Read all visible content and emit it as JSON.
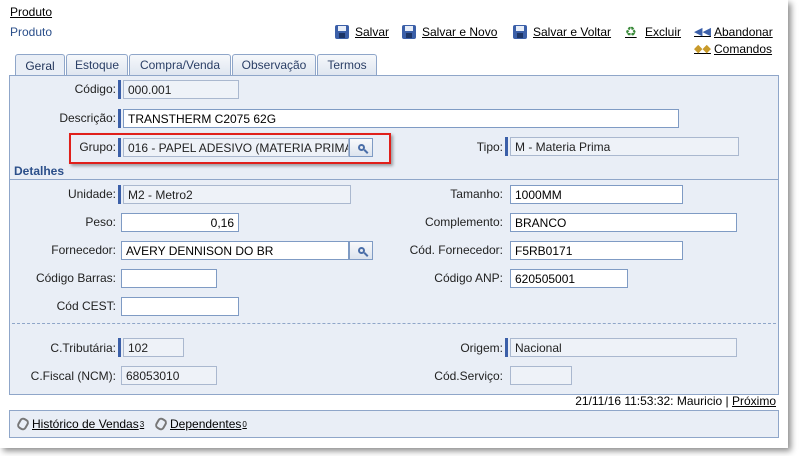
{
  "breadcrumb": "Produto",
  "page_title": "Produto",
  "toolbar": {
    "salvar": "Salvar",
    "salvar_novo": "Salvar e Novo",
    "salvar_voltar": "Salvar e Voltar",
    "excluir": "Excluir",
    "abandonar": "Abandonar",
    "comandos": "Comandos"
  },
  "tabs": [
    "Geral",
    "Estoque",
    "Compra/Venda",
    "Observação",
    "Termos"
  ],
  "active_tab": "Geral",
  "form": {
    "codigo": {
      "label": "Código:",
      "value": "000.001"
    },
    "descricao": {
      "label": "Descrição:",
      "value": "TRANSTHERM C2075 62G"
    },
    "grupo": {
      "label": "Grupo:",
      "value": "016 - PAPEL ADESIVO (MATERIA PRIMA"
    },
    "tipo": {
      "label": "Tipo:",
      "value": "M - Materia Prima"
    }
  },
  "detalhes": {
    "title": "Detalhes",
    "unidade": {
      "label": "Unidade:",
      "value": "M2 - Metro2"
    },
    "tamanho": {
      "label": "Tamanho:",
      "value": "1000MM"
    },
    "peso": {
      "label": "Peso:",
      "value": "0,16"
    },
    "complemento": {
      "label": "Complemento:",
      "value": "BRANCO"
    },
    "fornecedor": {
      "label": "Fornecedor:",
      "value": "AVERY DENNISON DO BR"
    },
    "cod_fornecedor": {
      "label": "Cód. Fornecedor:",
      "value": "F5RB0171"
    },
    "codigo_barras": {
      "label": "Código Barras:",
      "value": ""
    },
    "codigo_anp": {
      "label": "Código ANP:",
      "value": "620505001"
    },
    "cod_cest": {
      "label": "Cód CEST:",
      "value": ""
    }
  },
  "fiscal": {
    "c_tributaria": {
      "label": "C.Tributária:",
      "value": "102"
    },
    "origem": {
      "label": "Origem:",
      "value": "Nacional"
    },
    "c_fiscal": {
      "label": "C.Fiscal (NCM):",
      "value": "68053010"
    },
    "cod_servico": {
      "label": "Cód.Serviço:",
      "value": ""
    }
  },
  "status": {
    "text": "21/11/16 11:53:32: Mauricio |",
    "proximo": "Próximo"
  },
  "bottom": {
    "historico": "Histórico de Vendas",
    "historico_count": "3",
    "dependentes": "Dependentes",
    "dependentes_count": "0"
  },
  "colors": {
    "accent": "#3b5fa8",
    "panel": "#e9eef6",
    "highlight": "#e0201b"
  }
}
